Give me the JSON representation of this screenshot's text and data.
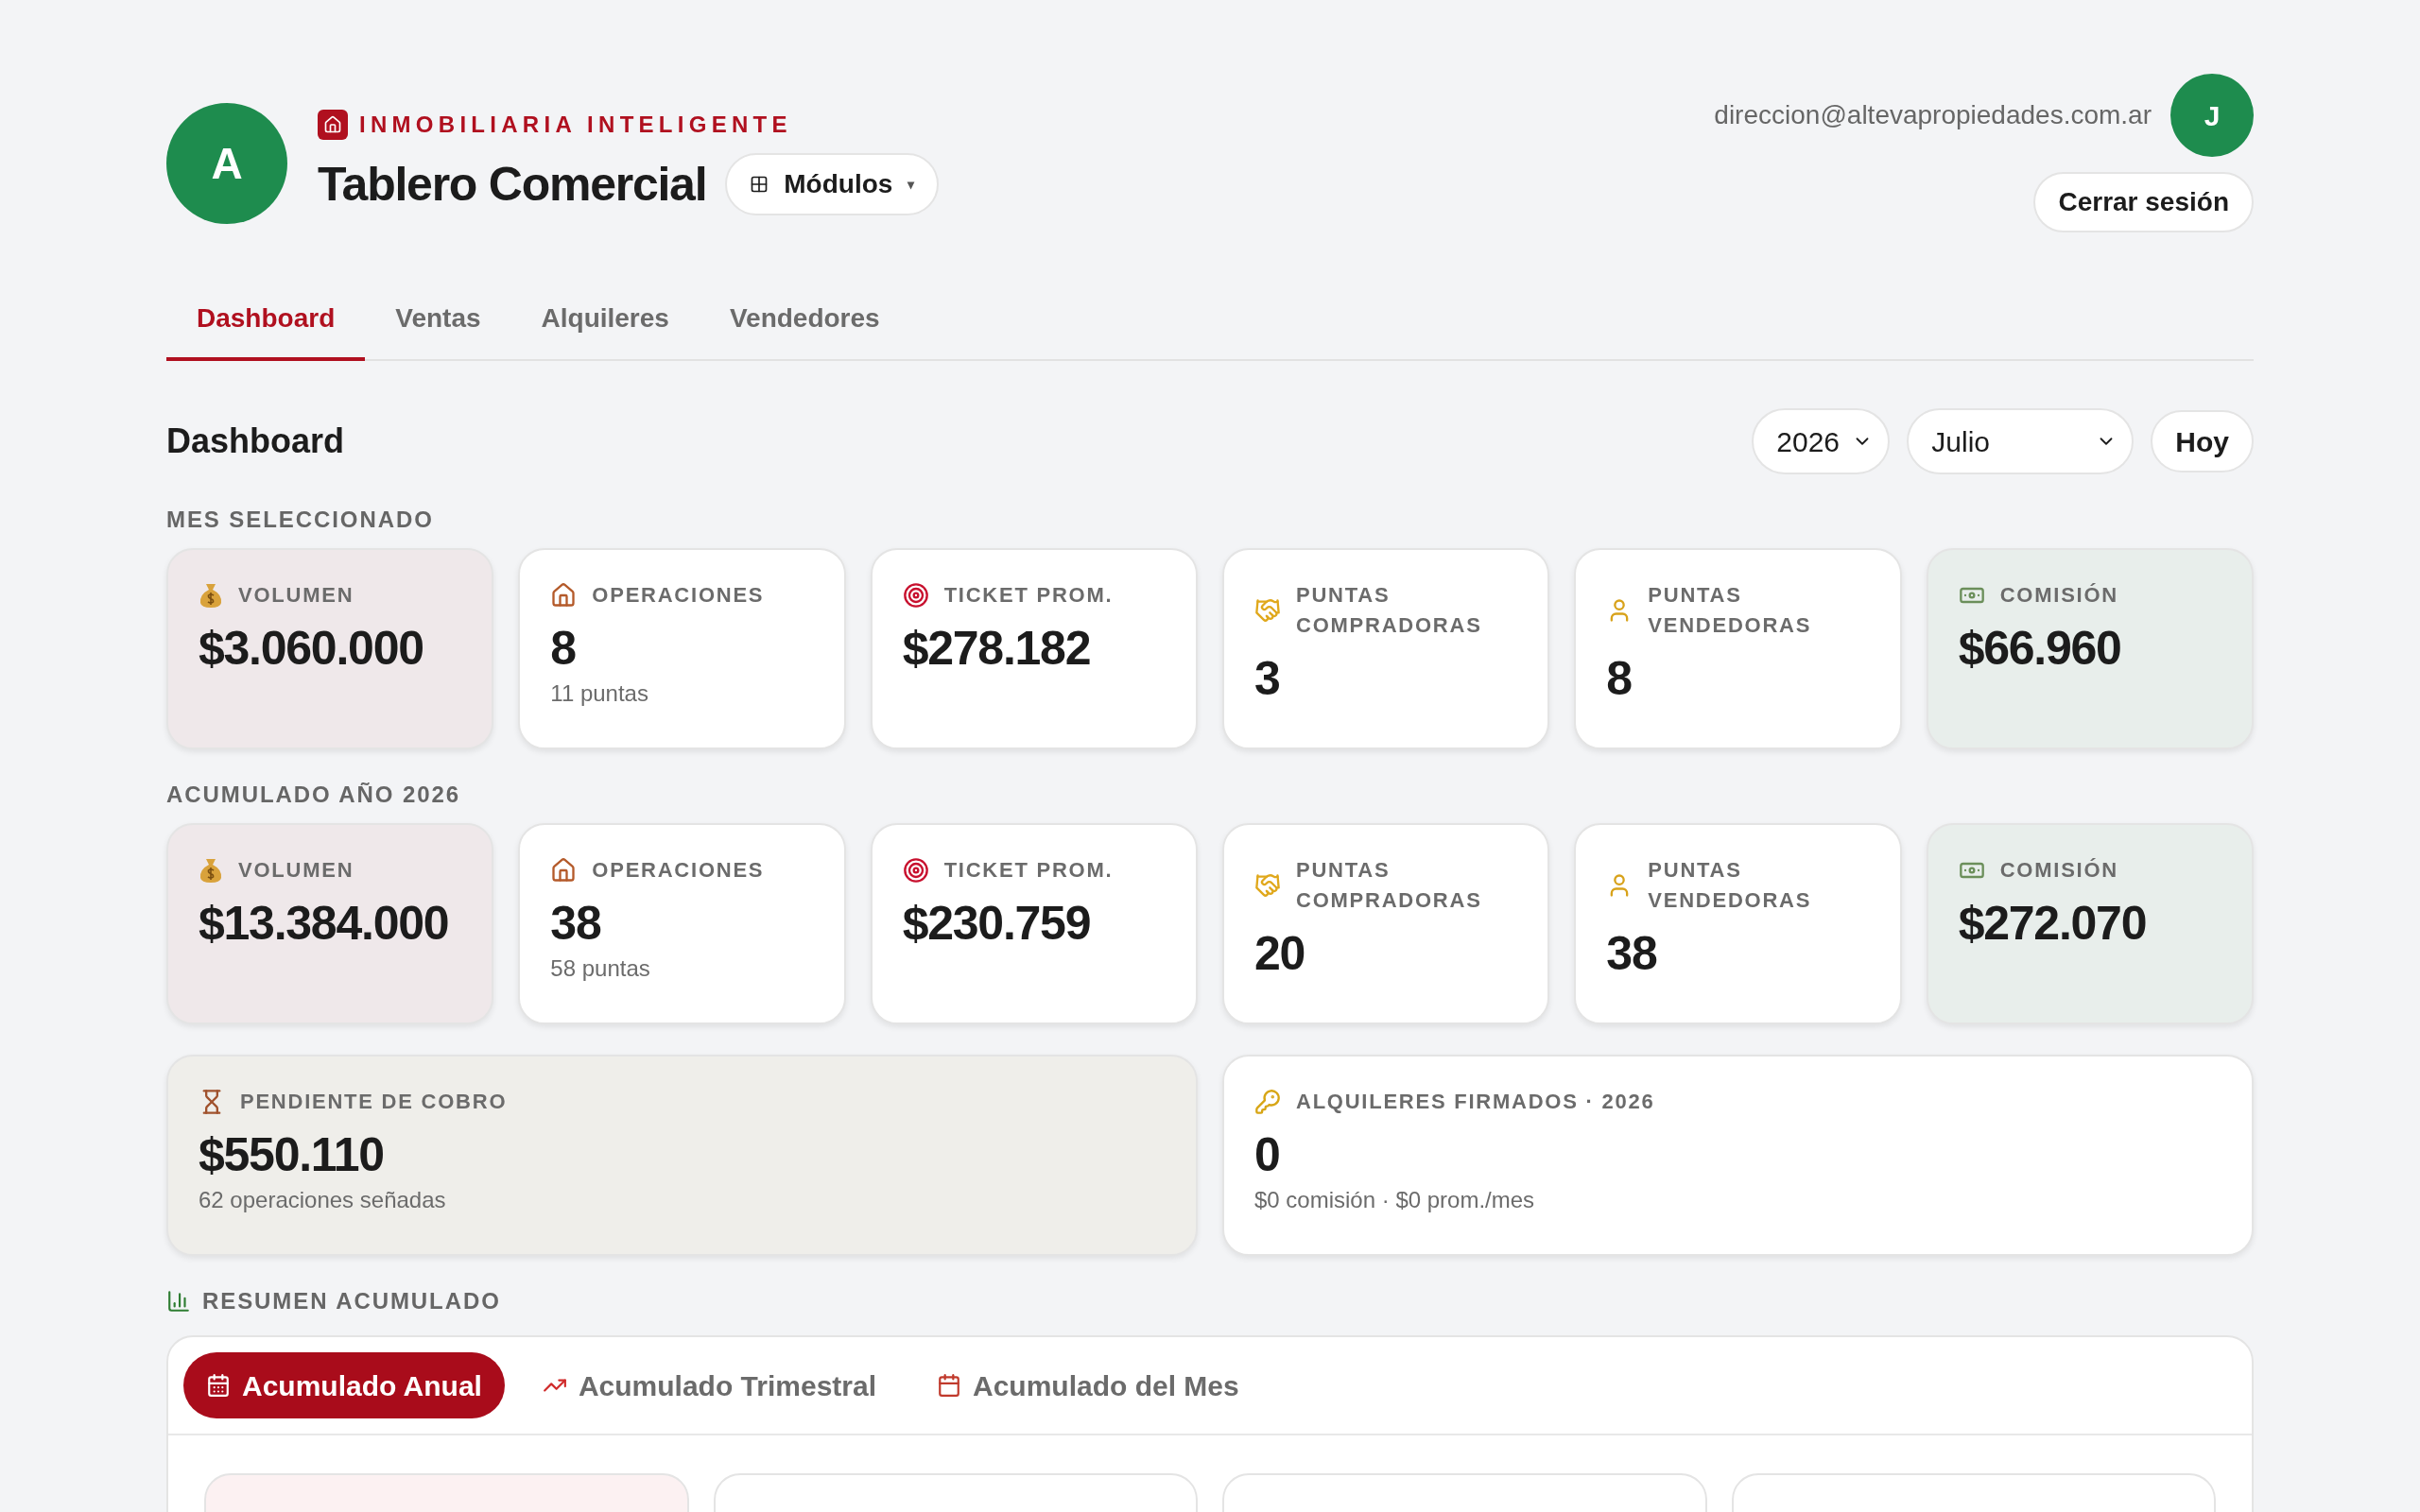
{
  "header": {
    "avatar_letter": "A",
    "brand": "INMOBILIARIA INTELIGENTE",
    "title": "Tablero Comercial",
    "modules_button": {
      "label": "Módulos",
      "caret": "▾"
    },
    "user_email": "direccion@altevapropiedades.com.ar",
    "user_initial": "J",
    "logout_button": "Cerrar sesión"
  },
  "tabs": [
    {
      "label": "Dashboard",
      "selected": true
    },
    {
      "label": "Ventas",
      "selected": false
    },
    {
      "label": "Alquileres",
      "selected": false
    },
    {
      "label": "Vendedores",
      "selected": false
    }
  ],
  "dashboard": {
    "title": "Dashboard",
    "year_select": "2026",
    "month_select": "Julio",
    "today_button": "Hoy"
  },
  "sections": [
    {
      "label": "MES SELECCIONADO",
      "cards": [
        {
          "label": "VOLUMEN",
          "value": "$3.060.000",
          "kind": "volume"
        },
        {
          "label": "OPERACIONES",
          "value": "8",
          "note": "11 puntas",
          "kind": "plain"
        },
        {
          "label": "TICKET PROM.",
          "value": "$278.182",
          "kind": "plain"
        },
        {
          "label": "PUNTAS COMPRADORAS",
          "value": "3",
          "kind": "plain"
        },
        {
          "label": "PUNTAS VENDEDORAS",
          "value": "8",
          "kind": "plain"
        },
        {
          "label": "COMISIÓN",
          "value": "$66.960",
          "kind": "commission"
        }
      ]
    },
    {
      "label": "ACUMULADO AÑO 2026",
      "cards": [
        {
          "label": "VOLUMEN",
          "value": "$13.384.000",
          "kind": "volume"
        },
        {
          "label": "OPERACIONES",
          "value": "38",
          "note": "58 puntas",
          "kind": "plain"
        },
        {
          "label": "TICKET PROM.",
          "value": "$230.759",
          "kind": "plain"
        },
        {
          "label": "PUNTAS COMPRADORAS",
          "value": "20",
          "kind": "plain"
        },
        {
          "label": "PUNTAS VENDEDORAS",
          "value": "38",
          "kind": "plain"
        },
        {
          "label": "COMISIÓN",
          "value": "$272.070",
          "kind": "commission"
        }
      ]
    }
  ],
  "wide_cards": [
    {
      "label": "PENDIENTE DE COBRO",
      "value": "$550.110",
      "note": "62 operaciones señadas",
      "kind": "pending"
    },
    {
      "label": "ALQUILERES FIRMADOS · 2026",
      "value": "0",
      "note": "$0 comisión · $0 prom./mes",
      "kind": "plain"
    }
  ],
  "summary": {
    "label": "RESUMEN ACUMULADO",
    "tabs": [
      {
        "label": "Acumulado Anual",
        "selected": true
      },
      {
        "label": "Acumulado Trimestral",
        "selected": false
      },
      {
        "label": "Acumulado del Mes",
        "selected": false
      }
    ],
    "cards": [
      {
        "kind": "volume"
      },
      {
        "kind": "plain"
      },
      {
        "kind": "plain"
      },
      {
        "kind": "plain"
      }
    ]
  }
}
